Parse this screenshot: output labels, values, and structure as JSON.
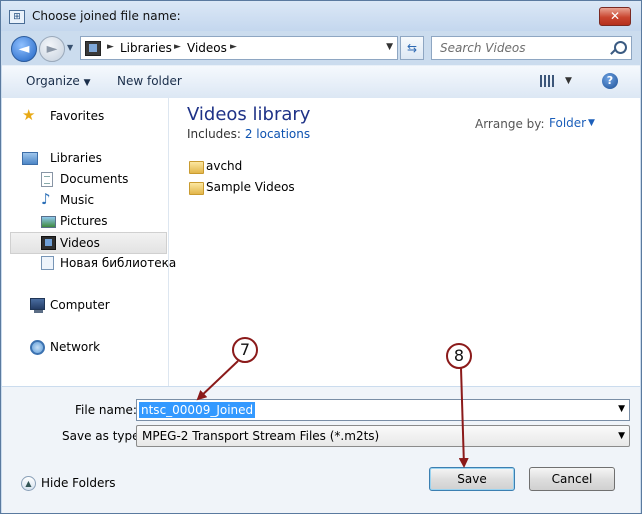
{
  "window": {
    "title": "Choose joined file name:",
    "close_glyph": "✕"
  },
  "nav": {
    "back_glyph": "◄",
    "forward_glyph": "►",
    "address": [
      "Libraries",
      "Videos"
    ],
    "search_placeholder": "Search Videos"
  },
  "toolbar": {
    "organize": "Organize",
    "new_folder": "New folder",
    "help": "?"
  },
  "sidebar": {
    "items": [
      {
        "label": "Favorites",
        "icon": "star-icon"
      },
      {
        "label": "Libraries",
        "icon": "libraries-icon"
      },
      {
        "label": "Documents",
        "icon": "documents-icon"
      },
      {
        "label": "Music",
        "icon": "music-icon"
      },
      {
        "label": "Pictures",
        "icon": "pictures-icon"
      },
      {
        "label": "Videos",
        "icon": "videos-icon",
        "selected": true
      },
      {
        "label": "Новая библиотека",
        "icon": "library-icon"
      },
      {
        "label": "Computer",
        "icon": "computer-icon"
      },
      {
        "label": "Network",
        "icon": "network-icon"
      }
    ]
  },
  "main": {
    "library_title": "Videos library",
    "includes_label": "Includes:",
    "includes_link": "2 locations",
    "arrange_label": "Arrange by:",
    "arrange_value": "Folder",
    "folders": [
      "avchd",
      "Sample Videos"
    ]
  },
  "form": {
    "file_name_label": "File name:",
    "file_name_value": "ntsc_00009_Joined",
    "save_type_label": "Save as type:",
    "save_type_value": "MPEG-2 Transport Stream Files (*.m2ts)",
    "hide_folders": "Hide Folders",
    "save": "Save",
    "cancel": "Cancel"
  },
  "annotations": {
    "seven": "7",
    "eight": "8",
    "color": "#8b1a1a"
  }
}
